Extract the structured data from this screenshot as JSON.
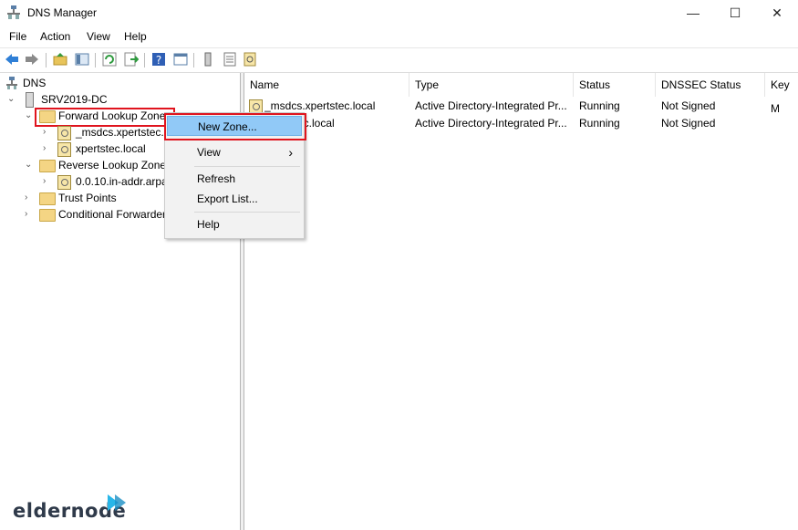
{
  "window": {
    "title": "DNS Manager",
    "minimize": "—",
    "maximize": "☐",
    "close": "✕"
  },
  "menu": [
    "File",
    "Action",
    "View",
    "Help"
  ],
  "toolbar_icons": [
    "back-icon",
    "forward-icon",
    "up-folder-icon",
    "show-hide-tree-icon",
    "refresh-icon",
    "export-icon",
    "help-icon",
    "properties-icon",
    "server-icon",
    "list-icon",
    "zone-icon"
  ],
  "tree": {
    "root": "DNS",
    "server": "SRV2019-DC",
    "forward": "Forward Lookup Zones",
    "forward_children": [
      "_msdcs.xpertstec.local",
      "xpertstec.local"
    ],
    "reverse": "Reverse Lookup Zones",
    "reverse_children": [
      "0.0.10.in-addr.arpa"
    ],
    "trust": "Trust Points",
    "conditional": "Conditional Forwarders"
  },
  "list": {
    "columns": [
      "Name",
      "Type",
      "Status",
      "DNSSEC Status",
      "Key M"
    ],
    "rows": [
      {
        "name": "_msdcs.xpertstec.local",
        "type": "Active Directory-Integrated Pr...",
        "status": "Running",
        "dnssec": "Not Signed"
      },
      {
        "name": "xpertstec.local",
        "type": "Active Directory-Integrated Pr...",
        "status": "Running",
        "dnssec": "Not Signed"
      }
    ]
  },
  "context_menu": {
    "new_zone": "New Zone...",
    "view": "View",
    "view_arrow": "›",
    "refresh": "Refresh",
    "export": "Export List...",
    "help": "Help"
  },
  "colors": {
    "highlight_border": "#e0141e",
    "menu_hover": "#91c9f7",
    "logo_accent": "#29b6e8"
  },
  "logo": {
    "text": "eldernode"
  }
}
